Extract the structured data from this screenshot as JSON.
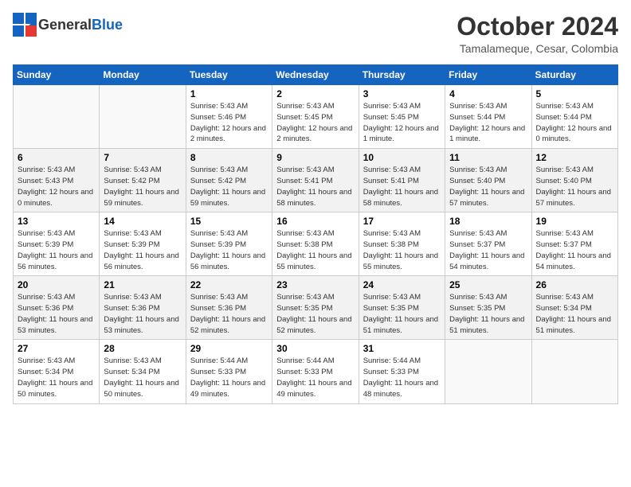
{
  "header": {
    "logo_general": "General",
    "logo_blue": "Blue",
    "month": "October 2024",
    "location": "Tamalameque, Cesar, Colombia"
  },
  "weekdays": [
    "Sunday",
    "Monday",
    "Tuesday",
    "Wednesday",
    "Thursday",
    "Friday",
    "Saturday"
  ],
  "weeks": [
    [
      {
        "day": "",
        "info": ""
      },
      {
        "day": "",
        "info": ""
      },
      {
        "day": "1",
        "info": "Sunrise: 5:43 AM\nSunset: 5:46 PM\nDaylight: 12 hours and 2 minutes."
      },
      {
        "day": "2",
        "info": "Sunrise: 5:43 AM\nSunset: 5:45 PM\nDaylight: 12 hours and 2 minutes."
      },
      {
        "day": "3",
        "info": "Sunrise: 5:43 AM\nSunset: 5:45 PM\nDaylight: 12 hours and 1 minute."
      },
      {
        "day": "4",
        "info": "Sunrise: 5:43 AM\nSunset: 5:44 PM\nDaylight: 12 hours and 1 minute."
      },
      {
        "day": "5",
        "info": "Sunrise: 5:43 AM\nSunset: 5:44 PM\nDaylight: 12 hours and 0 minutes."
      }
    ],
    [
      {
        "day": "6",
        "info": "Sunrise: 5:43 AM\nSunset: 5:43 PM\nDaylight: 12 hours and 0 minutes."
      },
      {
        "day": "7",
        "info": "Sunrise: 5:43 AM\nSunset: 5:42 PM\nDaylight: 11 hours and 59 minutes."
      },
      {
        "day": "8",
        "info": "Sunrise: 5:43 AM\nSunset: 5:42 PM\nDaylight: 11 hours and 59 minutes."
      },
      {
        "day": "9",
        "info": "Sunrise: 5:43 AM\nSunset: 5:41 PM\nDaylight: 11 hours and 58 minutes."
      },
      {
        "day": "10",
        "info": "Sunrise: 5:43 AM\nSunset: 5:41 PM\nDaylight: 11 hours and 58 minutes."
      },
      {
        "day": "11",
        "info": "Sunrise: 5:43 AM\nSunset: 5:40 PM\nDaylight: 11 hours and 57 minutes."
      },
      {
        "day": "12",
        "info": "Sunrise: 5:43 AM\nSunset: 5:40 PM\nDaylight: 11 hours and 57 minutes."
      }
    ],
    [
      {
        "day": "13",
        "info": "Sunrise: 5:43 AM\nSunset: 5:39 PM\nDaylight: 11 hours and 56 minutes."
      },
      {
        "day": "14",
        "info": "Sunrise: 5:43 AM\nSunset: 5:39 PM\nDaylight: 11 hours and 56 minutes."
      },
      {
        "day": "15",
        "info": "Sunrise: 5:43 AM\nSunset: 5:39 PM\nDaylight: 11 hours and 56 minutes."
      },
      {
        "day": "16",
        "info": "Sunrise: 5:43 AM\nSunset: 5:38 PM\nDaylight: 11 hours and 55 minutes."
      },
      {
        "day": "17",
        "info": "Sunrise: 5:43 AM\nSunset: 5:38 PM\nDaylight: 11 hours and 55 minutes."
      },
      {
        "day": "18",
        "info": "Sunrise: 5:43 AM\nSunset: 5:37 PM\nDaylight: 11 hours and 54 minutes."
      },
      {
        "day": "19",
        "info": "Sunrise: 5:43 AM\nSunset: 5:37 PM\nDaylight: 11 hours and 54 minutes."
      }
    ],
    [
      {
        "day": "20",
        "info": "Sunrise: 5:43 AM\nSunset: 5:36 PM\nDaylight: 11 hours and 53 minutes."
      },
      {
        "day": "21",
        "info": "Sunrise: 5:43 AM\nSunset: 5:36 PM\nDaylight: 11 hours and 53 minutes."
      },
      {
        "day": "22",
        "info": "Sunrise: 5:43 AM\nSunset: 5:36 PM\nDaylight: 11 hours and 52 minutes."
      },
      {
        "day": "23",
        "info": "Sunrise: 5:43 AM\nSunset: 5:35 PM\nDaylight: 11 hours and 52 minutes."
      },
      {
        "day": "24",
        "info": "Sunrise: 5:43 AM\nSunset: 5:35 PM\nDaylight: 11 hours and 51 minutes."
      },
      {
        "day": "25",
        "info": "Sunrise: 5:43 AM\nSunset: 5:35 PM\nDaylight: 11 hours and 51 minutes."
      },
      {
        "day": "26",
        "info": "Sunrise: 5:43 AM\nSunset: 5:34 PM\nDaylight: 11 hours and 51 minutes."
      }
    ],
    [
      {
        "day": "27",
        "info": "Sunrise: 5:43 AM\nSunset: 5:34 PM\nDaylight: 11 hours and 50 minutes."
      },
      {
        "day": "28",
        "info": "Sunrise: 5:43 AM\nSunset: 5:34 PM\nDaylight: 11 hours and 50 minutes."
      },
      {
        "day": "29",
        "info": "Sunrise: 5:44 AM\nSunset: 5:33 PM\nDaylight: 11 hours and 49 minutes."
      },
      {
        "day": "30",
        "info": "Sunrise: 5:44 AM\nSunset: 5:33 PM\nDaylight: 11 hours and 49 minutes."
      },
      {
        "day": "31",
        "info": "Sunrise: 5:44 AM\nSunset: 5:33 PM\nDaylight: 11 hours and 48 minutes."
      },
      {
        "day": "",
        "info": ""
      },
      {
        "day": "",
        "info": ""
      }
    ]
  ]
}
